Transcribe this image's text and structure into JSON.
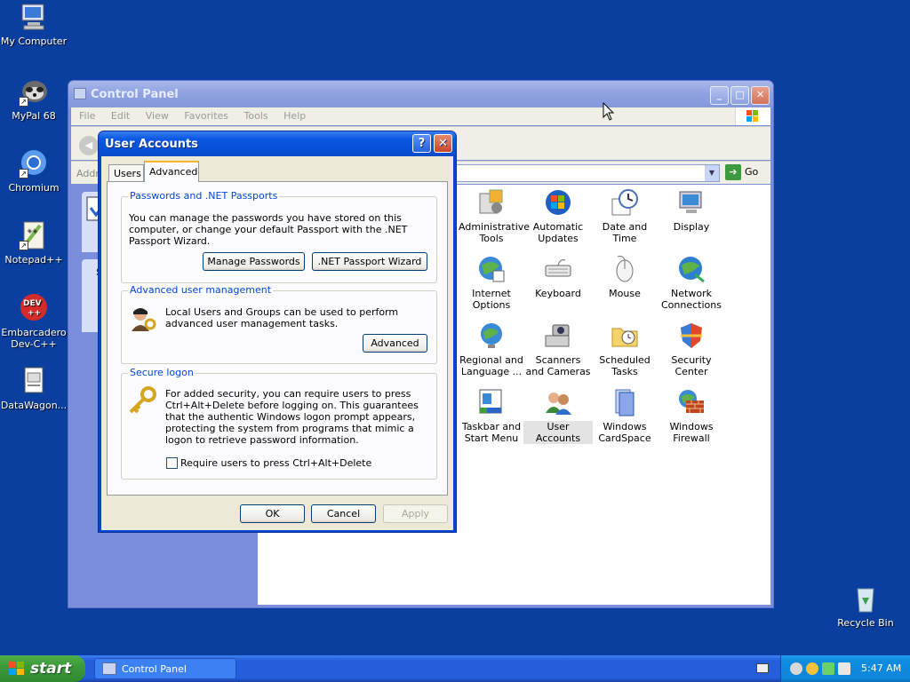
{
  "desktop": {
    "icons": [
      {
        "label": "My Computer"
      },
      {
        "label": "MyPal 68"
      },
      {
        "label": "Chromium"
      },
      {
        "label": "Notepad++"
      },
      {
        "label": "Embarcadero Dev-C++"
      },
      {
        "label": "DataWagon..."
      },
      {
        "label": "Recycle Bin"
      }
    ]
  },
  "control_panel": {
    "title": "Control Panel",
    "menu": [
      "File",
      "Edit",
      "View",
      "Favorites",
      "Tools",
      "Help"
    ],
    "address_label": "Addre",
    "go_label": "Go",
    "items": [
      {
        "label": "Administrative Tools",
        "icon": "administrative-tools-icon"
      },
      {
        "label": "Automatic Updates",
        "icon": "automatic-updates-icon"
      },
      {
        "label": "Date and Time",
        "icon": "date-time-icon"
      },
      {
        "label": "Display",
        "icon": "display-icon"
      },
      {
        "label": "Internet Options",
        "icon": "internet-options-icon"
      },
      {
        "label": "Keyboard",
        "icon": "keyboard-icon"
      },
      {
        "label": "Mouse",
        "icon": "mouse-icon"
      },
      {
        "label": "Network Connections",
        "icon": "network-connections-icon"
      },
      {
        "label": "Regional and Language ...",
        "icon": "regional-language-icon"
      },
      {
        "label": "Scanners and Cameras",
        "icon": "scanners-cameras-icon"
      },
      {
        "label": "Scheduled Tasks",
        "icon": "scheduled-tasks-icon"
      },
      {
        "label": "Security Center",
        "icon": "security-center-icon"
      },
      {
        "label": "Taskbar and Start Menu",
        "icon": "taskbar-start-menu-icon"
      },
      {
        "label": "User Accounts",
        "icon": "user-accounts-icon"
      },
      {
        "label": "Windows CardSpace",
        "icon": "cardspace-icon"
      },
      {
        "label": "Windows Firewall",
        "icon": "firewall-icon"
      }
    ],
    "sidebar_fragment": "S"
  },
  "dialog": {
    "title": "User Accounts",
    "help_glyph": "?",
    "close_glyph": "✕",
    "tabs": [
      {
        "label": "Users",
        "active": false
      },
      {
        "label": "Advanced",
        "active": true
      }
    ],
    "passwords": {
      "title": "Passwords and .NET Passports",
      "text": "You can manage the passwords you have stored on this computer, or change your default Passport with the .NET Passport Wizard.",
      "manage_button": "Manage Passwords",
      "wizard_button": ".NET Passport Wizard"
    },
    "advanced_mgmt": {
      "title": "Advanced user management",
      "text": "Local Users and Groups can be used to perform advanced user management tasks.",
      "button": "Advanced"
    },
    "secure_logon": {
      "title": "Secure logon",
      "text": "For added security, you can require users to press Ctrl+Alt+Delete before logging on. This guarantees that the authentic Windows logon prompt appears, protecting the system from programs that mimic a logon to retrieve password information.",
      "checkbox_label": "Require users to press Ctrl+Alt+Delete",
      "checked": false
    },
    "ok": "OK",
    "cancel": "Cancel",
    "apply": "Apply"
  },
  "taskbar": {
    "start": "start",
    "task": "Control Panel",
    "clock": "5:47 AM"
  },
  "colors": {
    "desktop": "#0a3fa0",
    "xp_blue": "#0a45d0",
    "group_title": "#0046d5"
  }
}
